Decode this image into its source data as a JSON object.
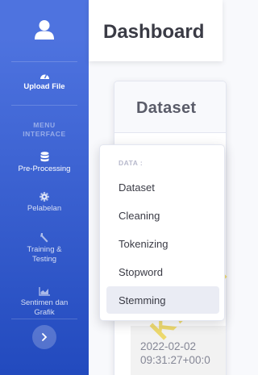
{
  "sidebar": {
    "upload_label": "Upload File",
    "heading": "MENU\nINTERFACE",
    "items": [
      {
        "label": "Pre-Processing",
        "icon": "database-icon"
      },
      {
        "label": "Pelabelan",
        "icon": "gear-icon"
      },
      {
        "label": "Training &\nTesting",
        "icon": "wrench-icon"
      },
      {
        "label": "Sentimen dan\nGrafik",
        "icon": "chart-area-icon"
      }
    ]
  },
  "topbar": {
    "title": "Dashboard"
  },
  "card": {
    "title": "Dataset",
    "row_value": "2022-02-02\n09:31:27+00:0"
  },
  "dropdown": {
    "header": "DATA :",
    "items": [
      "Dataset",
      "Cleaning",
      "Tokenizing",
      "Stopword",
      "Stemming"
    ],
    "active_index": 4
  },
  "watermark": "KAAN",
  "colors": {
    "sidebar_top": "#4e73df",
    "sidebar_bottom": "#224abe",
    "watermark": "#e9c400"
  }
}
